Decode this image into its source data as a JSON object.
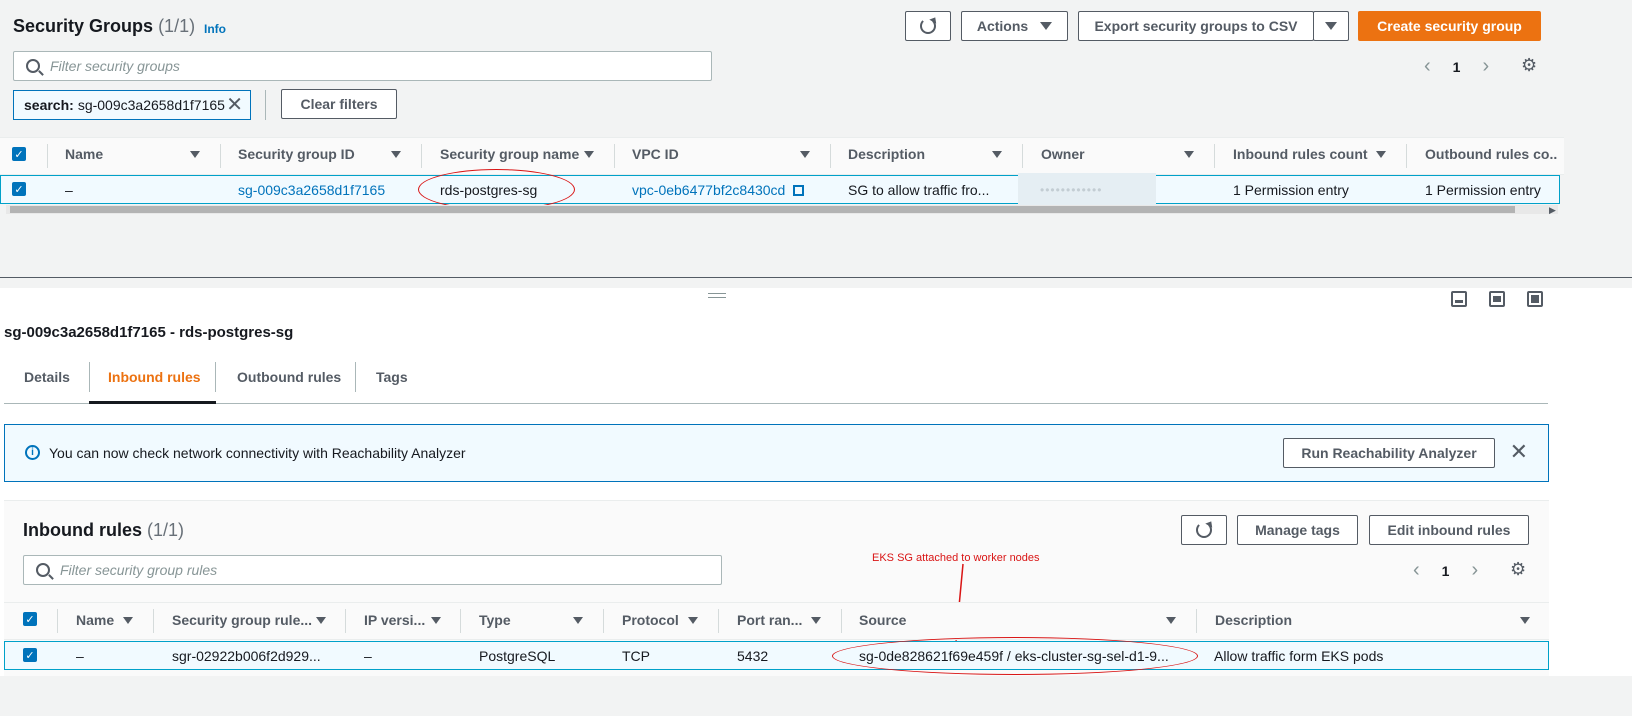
{
  "header": {
    "title": "Security Groups",
    "count": "(1/1)",
    "info": "Info",
    "actions_label": "Actions",
    "export_label": "Export security groups to CSV",
    "create_label": "Create security group"
  },
  "filter": {
    "placeholder": "Filter security groups",
    "chip_key": "search:",
    "chip_value": "sg-009c3a2658d1f7165",
    "clear_label": "Clear filters"
  },
  "pager": {
    "page": "1"
  },
  "sg_table": {
    "columns": [
      "Name",
      "Security group ID",
      "Security group name",
      "VPC ID",
      "Description",
      "Owner",
      "Inbound rules count",
      "Outbound rules co..."
    ],
    "rows": [
      {
        "name": "–",
        "sg_id": "sg-009c3a2658d1f7165",
        "sg_name": "rds-postgres-sg",
        "vpc_id": "vpc-0eb6477bf2c8430cd",
        "description": "SG to allow traffic fro...",
        "owner": "••••••••••••",
        "inbound_count": "1 Permission entry",
        "outbound_count": "1 Permission entry"
      }
    ]
  },
  "details": {
    "title": "sg-009c3a2658d1f7165 - rds-postgres-sg",
    "tabs": [
      "Details",
      "Inbound rules",
      "Outbound rules",
      "Tags"
    ],
    "active_tab": "Inbound rules"
  },
  "flash": {
    "message": "You can now check network connectivity with Reachability Analyzer",
    "button": "Run Reachability Analyzer"
  },
  "inbound": {
    "title": "Inbound rules",
    "count": "(1/1)",
    "manage_tags": "Manage tags",
    "edit_rules": "Edit inbound rules",
    "placeholder": "Filter security group rules",
    "page": "1",
    "columns": [
      "Name",
      "Security group rule...",
      "IP versi...",
      "Type",
      "Protocol",
      "Port ran...",
      "Source",
      "Description"
    ],
    "rows": [
      {
        "name": "–",
        "rule_id": "sgr-02922b006f2d929...",
        "ip_version": "–",
        "type": "PostgreSQL",
        "protocol": "TCP",
        "port_range": "5432",
        "source": "sg-0de828621f69e459f / eks-cluster-sg-sel-d1-9...",
        "description": "Allow traffic form EKS pods"
      }
    ]
  },
  "annotation": {
    "text": "EKS SG attached to worker nodes",
    "color": "#d91515"
  },
  "colors": {
    "accent": "#ec7211",
    "link": "#0073bb",
    "selected_bg": "#f1faff"
  }
}
